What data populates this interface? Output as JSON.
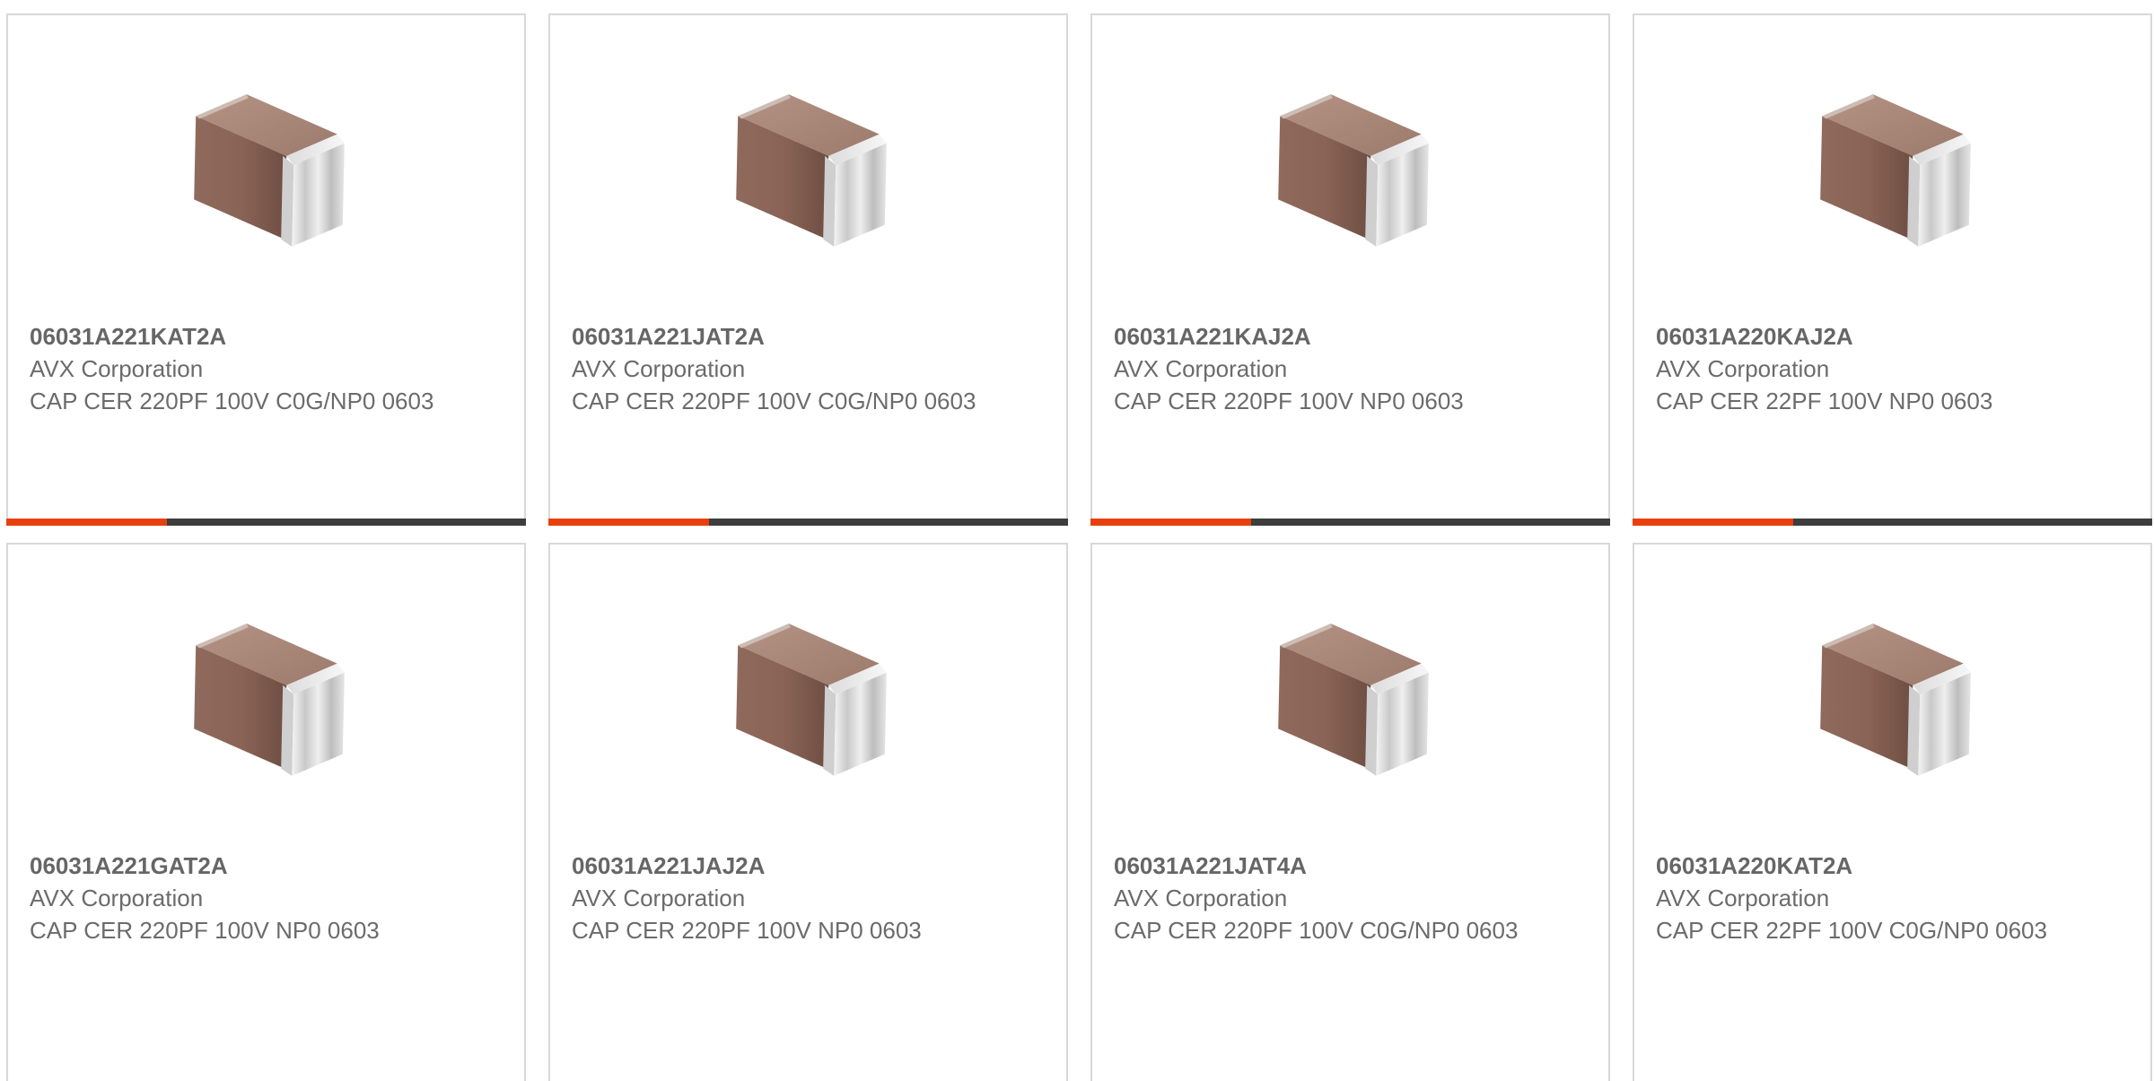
{
  "colors": {
    "accent": "#e8400c",
    "bar_track": "#3d3d3d",
    "text": "#666666",
    "border": "#d8d8d8"
  },
  "products": [
    {
      "part_number": "06031A221KAT2A",
      "manufacturer": "AVX Corporation",
      "description": "CAP CER 220PF 100V C0G/NP0 0603",
      "image_icon": "ceramic-capacitor-chip-icon",
      "progress_fraction": 0.31
    },
    {
      "part_number": "06031A221JAT2A",
      "manufacturer": "AVX Corporation",
      "description": "CAP CER 220PF 100V C0G/NP0 0603",
      "image_icon": "ceramic-capacitor-chip-icon",
      "progress_fraction": 0.31
    },
    {
      "part_number": "06031A221KAJ2A",
      "manufacturer": "AVX Corporation",
      "description": "CAP CER 220PF 100V NP0 0603",
      "image_icon": "ceramic-capacitor-chip-icon",
      "progress_fraction": 0.31
    },
    {
      "part_number": "06031A220KAJ2A",
      "manufacturer": "AVX Corporation",
      "description": "CAP CER 22PF 100V NP0 0603",
      "image_icon": "ceramic-capacitor-chip-icon",
      "progress_fraction": 0.31
    },
    {
      "part_number": "06031A221GAT2A",
      "manufacturer": "AVX Corporation",
      "description": "CAP CER 220PF 100V NP0 0603",
      "image_icon": "ceramic-capacitor-chip-icon"
    },
    {
      "part_number": "06031A221JAJ2A",
      "manufacturer": "AVX Corporation",
      "description": "CAP CER 220PF 100V NP0 0603",
      "image_icon": "ceramic-capacitor-chip-icon"
    },
    {
      "part_number": "06031A221JAT4A",
      "manufacturer": "AVX Corporation",
      "description": "CAP CER 220PF 100V C0G/NP0 0603",
      "image_icon": "ceramic-capacitor-chip-icon"
    },
    {
      "part_number": "06031A220KAT2A",
      "manufacturer": "AVX Corporation",
      "description": "CAP CER 22PF 100V C0G/NP0 0603",
      "image_icon": "ceramic-capacitor-chip-icon"
    }
  ]
}
